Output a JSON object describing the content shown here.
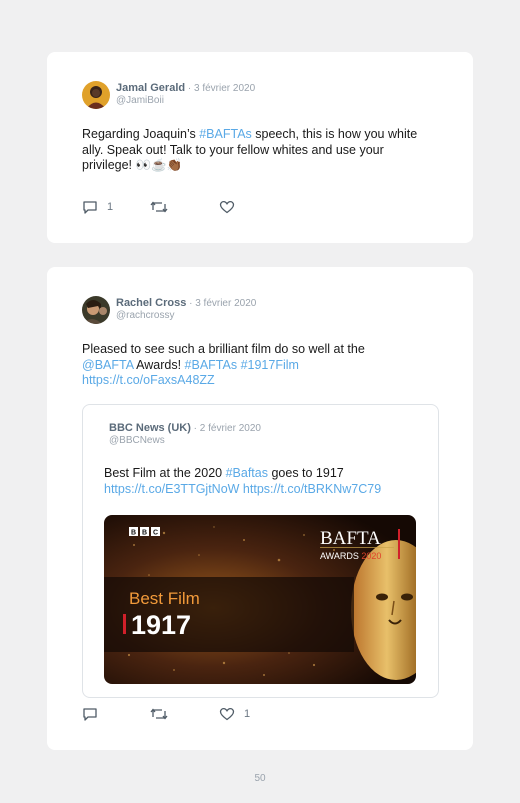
{
  "tweets": [
    {
      "name": "Jamal Gerald",
      "date": " · 3 février 2020",
      "handle": "@JamiBoii",
      "text": {
        "part1": "Regarding Joaquin’s ",
        "hashtag": "#BAFTAs",
        "part2": " speech, this is how you white ally. Speak out! Talk to your fellow whites and use your privilege! 👀☕👏🏾"
      },
      "reply_count": "1",
      "retweet_count": "",
      "like_count": ""
    },
    {
      "name": "Rachel Cross",
      "date": " · 3 février 2020",
      "handle": "@rachcrossy",
      "text": {
        "part1": "Pleased to see such a brilliant film do so well at the ",
        "mention": "@BAFTA",
        "part2": " Awards! ",
        "hashtags": "#BAFTAs #1917Film",
        "url": "https://t.co/oFaxsA48ZZ"
      },
      "reply_count": "",
      "retweet_count": "",
      "like_count": "1",
      "quoted": {
        "name": "BBC News (UK)",
        "date": " · 2 février 2020",
        "handle": "@BBCNews",
        "text": {
          "part1": "Best Film at the 2020 ",
          "hashtag": "#Baftas",
          "part2": " goes to 1917",
          "urls": "https://t.co/E3TTGjtNoW https://t.co/tBRKNw7C79"
        },
        "media": {
          "bbc_logo": "BBC",
          "bafta_title": "BAFTA",
          "awards_label": "AWARDS",
          "awards_year": "2020",
          "category": "Best Film",
          "winner": "1917"
        }
      }
    }
  ],
  "page_number": "50",
  "colors": {
    "link": "#5aa9e6",
    "background": "#f0f0f1",
    "card": "#ffffff",
    "award_gold": "#c9a24a",
    "bafta_red": "#d1202a"
  },
  "icons": [
    "reply-icon",
    "retweet-icon",
    "like-icon"
  ]
}
